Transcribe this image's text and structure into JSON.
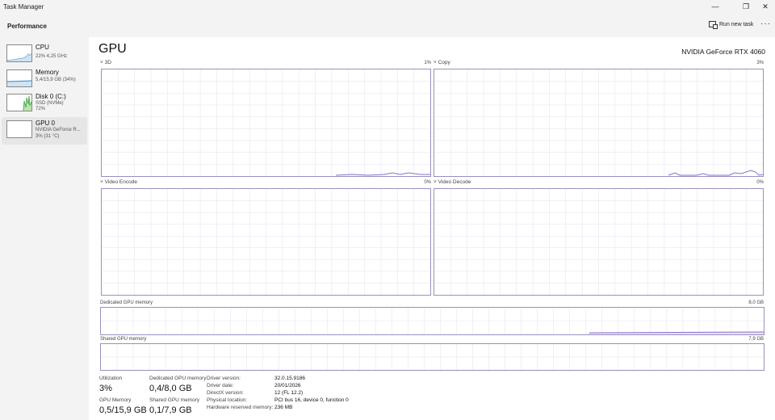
{
  "window": {
    "title": "Task Manager",
    "minimize": "—",
    "restore": "❐",
    "close": "✕"
  },
  "header": {
    "section": "Performance",
    "run_new_task": "Run new task",
    "more": "···"
  },
  "sidebar": {
    "items": [
      {
        "name": "CPU",
        "sub1": "22% 4,25 GHz",
        "sub2": ""
      },
      {
        "name": "Memory",
        "sub1": "5,4/15,9 GB (34%)",
        "sub2": ""
      },
      {
        "name": "Disk 0 (C:)",
        "sub1": "SSD (NVMe)",
        "sub2": "72%"
      },
      {
        "name": "GPU 0",
        "sub1": "NVIDIA GeForce R...",
        "sub2": "3% (31 °C)"
      }
    ]
  },
  "main": {
    "title": "GPU",
    "model": "NVIDIA GeForce RTX 4060",
    "engines": [
      {
        "label": "3D",
        "value": "1%"
      },
      {
        "label": "Copy",
        "value": "3%"
      },
      {
        "label": "Video Encode",
        "value": "0%"
      },
      {
        "label": "Video Decode",
        "value": "0%"
      }
    ],
    "dedicated": {
      "label": "Dedicated GPU memory",
      "value": "8,0 GB"
    },
    "shared": {
      "label": "Shared GPU memory",
      "value": "7,9 GB"
    },
    "stats": {
      "utilization_label": "Utilization",
      "utilization_value": "3%",
      "dedicated_label": "Dedicated GPU memory",
      "dedicated_value": "0,4/8,0 GB",
      "gpumem_label": "GPU Memory",
      "gpumem_value": "0,5/15,9 GB",
      "shared_label": "Shared GPU memory",
      "shared_value": "0,1/7,9 GB"
    },
    "props": [
      {
        "k": "Driver version:",
        "v": "32.0.15.9186"
      },
      {
        "k": "Driver date:",
        "v": "20/01/2026"
      },
      {
        "k": "DirectX version:",
        "v": "12 (FL 12.2)"
      },
      {
        "k": "Physical location:",
        "v": "PCI bus 16, device 0, function 0"
      },
      {
        "k": "Hardware reserved memory:",
        "v": "236 MB"
      }
    ]
  },
  "colors": {
    "accent": "#9c8fbf",
    "grid": "#e3e0ee",
    "line": "#8a6fd0"
  }
}
